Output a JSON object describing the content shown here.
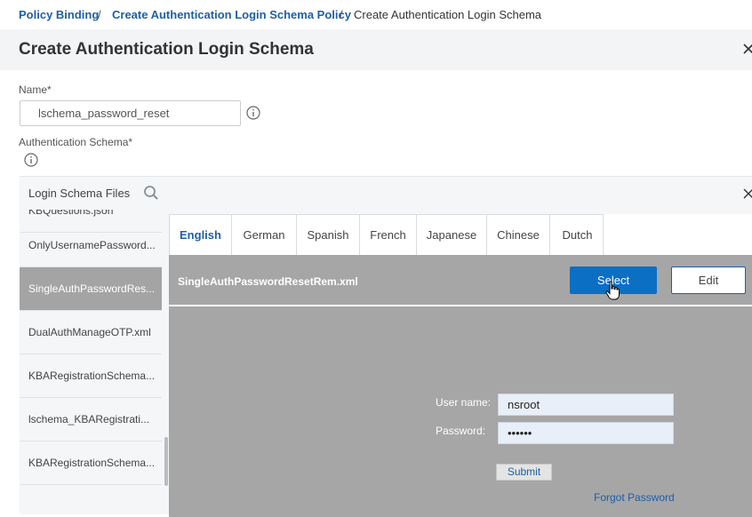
{
  "breadcrumb": {
    "items": [
      "Policy Binding",
      "Create Authentication Login Schema Policy"
    ],
    "current": "Create Authentication Login Schema",
    "separator": "/"
  },
  "dialog": {
    "title": "Create Authentication Login Schema",
    "close_icon": "close-icon"
  },
  "form": {
    "name_label": "Name*",
    "name_value": "lschema_password_reset",
    "schema_label": "Authentication Schema*",
    "info_icon": "info-icon"
  },
  "login_schema_files": {
    "header": "Login Schema Files",
    "search_icon": "search-icon",
    "close_icon": "close-icon",
    "items": [
      "KBQuestions.json",
      "OnlyUsernamePassword...",
      "SingleAuthPasswordRes...",
      "DualAuthManageOTP.xml",
      "KBARegistrationSchema...",
      "lschema_KBARegistrati...",
      "KBARegistrationSchema..."
    ],
    "selected_index": 2
  },
  "preview": {
    "tabs": [
      "English",
      "German",
      "Spanish",
      "French",
      "Japanese",
      "Chinese",
      "Dutch"
    ],
    "active_tab": "English",
    "filename": "SingleAuthPasswordResetRem.xml",
    "select_label": "Select",
    "edit_label": "Edit",
    "username_label": "User name:",
    "username_value": "nsroot",
    "password_label": "Password:",
    "password_value": "••••••",
    "submit_label": "Submit",
    "forgot_label": "Forgot Password"
  },
  "colors": {
    "accent": "#0b6fc4",
    "link": "#1f5fa8",
    "preview_bg": "#a6a6a6",
    "selected_item_bg": "#a4a4a4"
  }
}
